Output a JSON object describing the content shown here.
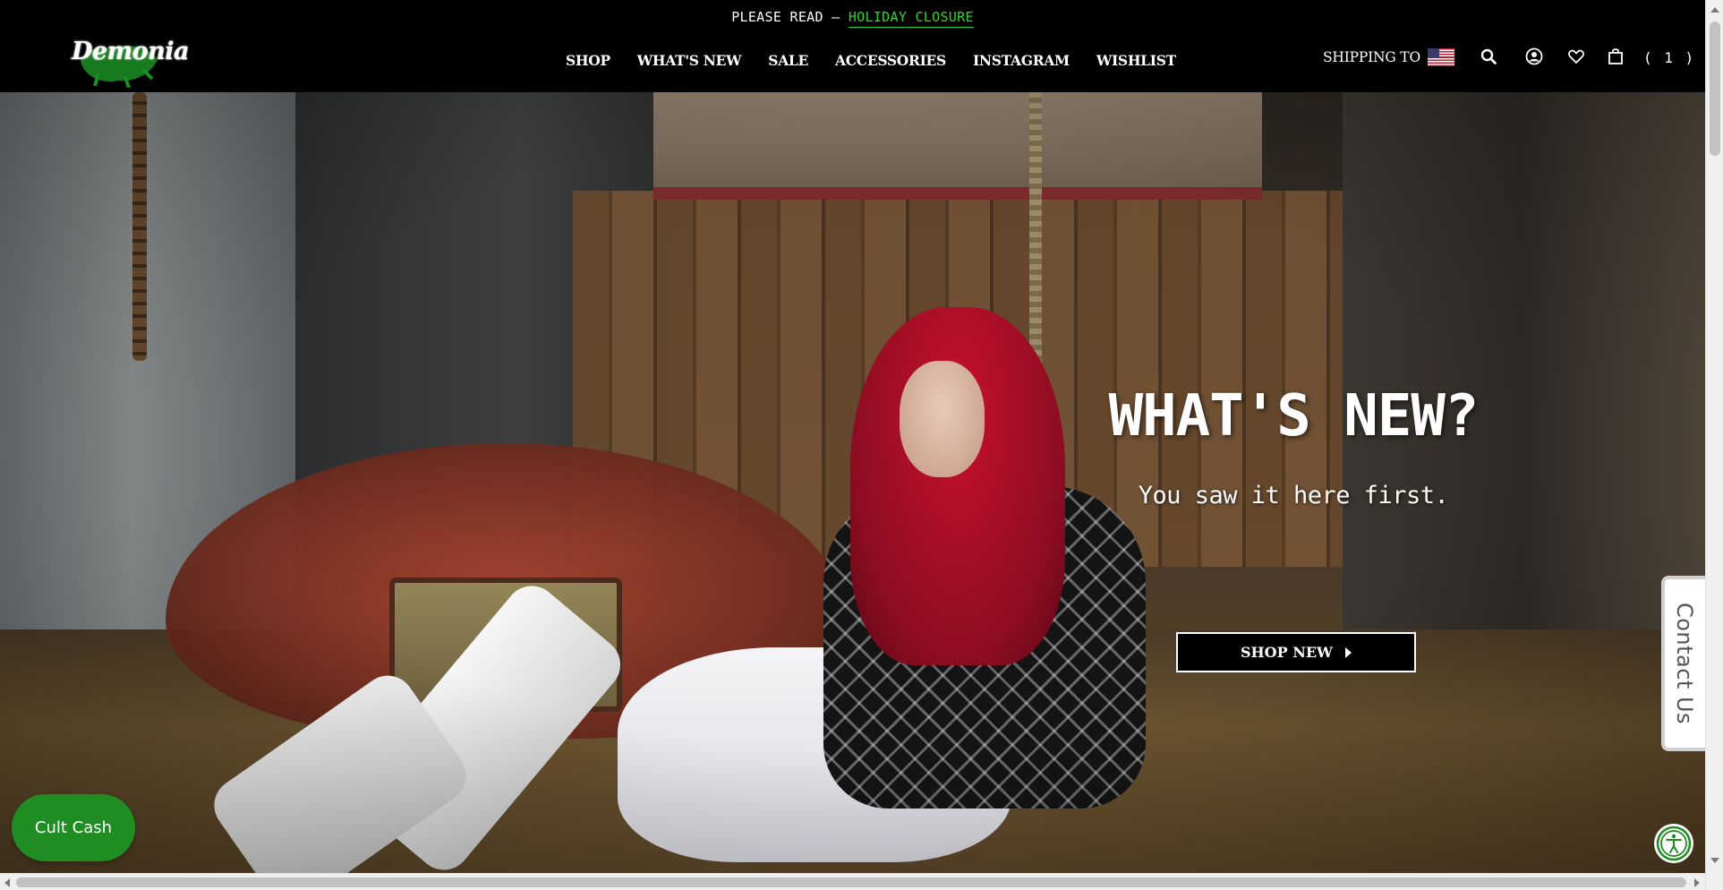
{
  "announcement": {
    "prefix": "PLEASE READ – ",
    "link_label": "HOLIDAY CLOSURE",
    "link_color": "#2fd52f"
  },
  "header": {
    "logo_text": "Demonia",
    "nav": [
      {
        "label": "SHOP"
      },
      {
        "label": "WHAT'S NEW"
      },
      {
        "label": "SALE"
      },
      {
        "label": "ACCESSORIES"
      },
      {
        "label": "INSTAGRAM"
      },
      {
        "label": "WISHLIST"
      }
    ],
    "shipping_label": "SHIPPING TO",
    "shipping_flag_icon": "us-flag-icon",
    "icons": [
      "search-icon",
      "account-icon",
      "heart-icon",
      "shopping-bag-icon"
    ],
    "cart_count": "( 1 )"
  },
  "hero": {
    "title": "WHAT'S NEW?",
    "subtitle": "You saw it here first.",
    "button_label": "SHOP NEW",
    "button_icon": "caret-right-icon"
  },
  "widgets": {
    "contact_tab_label": "Contact Us",
    "cult_cash_label": "Cult Cash",
    "cult_cash_color": "#1f8d21",
    "accessibility_icon": "accessibility-icon"
  }
}
